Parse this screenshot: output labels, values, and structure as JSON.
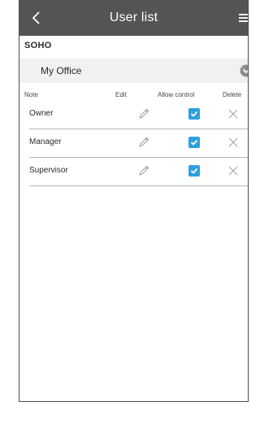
{
  "header": {
    "title": "User list",
    "back_icon": "chevron-left-icon",
    "menu_icon": "hamburger-menu-icon",
    "bar_color": "#545454"
  },
  "group": {
    "label": "SOHO"
  },
  "office_select": {
    "value": "My Office",
    "icon": "chevron-down-circle-icon"
  },
  "table": {
    "columns": {
      "note": "Note",
      "edit": "Edit",
      "allow_control": "Allow control",
      "delete": "Delete"
    },
    "rows": [
      {
        "name": "Owner",
        "allow_control": true
      },
      {
        "name": "Manager",
        "allow_control": true
      },
      {
        "name": "Supervisor",
        "allow_control": true
      }
    ]
  },
  "colors": {
    "accent": "#2e9fe0"
  }
}
